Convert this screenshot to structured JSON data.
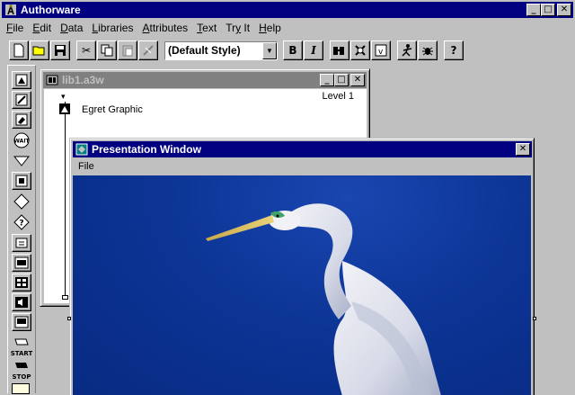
{
  "app": {
    "title": "Authorware",
    "menu": [
      "File",
      "Edit",
      "Data",
      "Libraries",
      "Attributes",
      "Text",
      "Try It",
      "Help"
    ],
    "menu_mnemonic": [
      "F",
      "E",
      "D",
      "L",
      "A",
      "T",
      "y",
      "H"
    ],
    "style_combo": {
      "value": "(Default Style)"
    },
    "toolbar": {
      "bold": "B",
      "italic": "I",
      "help": "?"
    },
    "palette": {
      "start_label": "START",
      "stop_label": "STOP",
      "wait_label": "WAIT"
    }
  },
  "library_window": {
    "title": "lib1.a3w",
    "level": "Level 1",
    "items": [
      {
        "label": "Egret Graphic",
        "icon": "display-icon"
      }
    ]
  },
  "presentation_window": {
    "title": "Presentation Window",
    "menu": [
      "File"
    ],
    "image": {
      "subject": "egret-photo"
    }
  },
  "colors": {
    "active_title": "#000080",
    "inactive_title": "#808080",
    "desktop": "#808080",
    "face": "#c0c0c0",
    "sky": "#0c3596"
  }
}
